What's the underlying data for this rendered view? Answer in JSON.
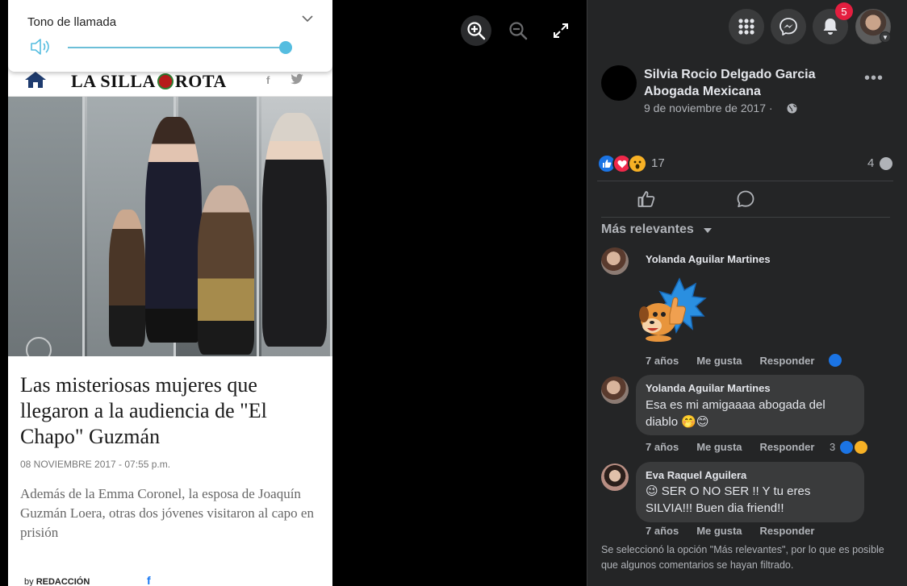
{
  "ringtone": {
    "title": "Tono de llamada",
    "volume": 1.0
  },
  "article": {
    "site_name": "LA SILLA",
    "site_name_2": "ROTA",
    "headline": "Las misteriosas mujeres que llegaron a la audiencia de \"El Chapo\" Guzmán",
    "date": "08 NOVIEMBRE 2017 - 07:55 p.m.",
    "lead": "Además de la Emma Coronel, la esposa de Joaquín Guzmán Loera, otras dos jóvenes visitaron al capo en prisión",
    "byline_prefix": "by ",
    "byline_author": "REDACCIÓN",
    "social_fb": "f"
  },
  "viewer": {
    "zoom_in": "zoom-in",
    "zoom_out": "zoom-out",
    "fullscreen": "fullscreen"
  },
  "topbar": {
    "notifications_count": "5"
  },
  "post": {
    "author": "Silvia Rocio Delgado Garcia Abogada Mexicana",
    "date": "9 de noviembre de 2017 ·",
    "menu": "•••",
    "reactions_count": "17",
    "comments_count": "4"
  },
  "comments_section": {
    "sort_label": "Más relevantes",
    "comments": [
      {
        "author": "Yolanda Aguilar Martines",
        "text": "",
        "age": "7 años",
        "like": "Me gusta",
        "reply": "Responder"
      },
      {
        "author": "Yolanda Aguilar Martines",
        "text": "Esa es mi amigaaaa abogada del diablo 🤭😊",
        "age": "7 años",
        "like": "Me gusta",
        "reply": "Responder",
        "reaction_count": "3"
      },
      {
        "author": "Eva Raquel Aguilera",
        "text": "😉 SER O NO SER !! Y tu eres SILVIA!!! Buen dia friend!!",
        "age": "7 años",
        "like": "Me gusta",
        "reply": "Responder"
      }
    ],
    "footer_note": "Se seleccionó la opción \"Más relevantes\", por lo que es posible que algunos comentarios se hayan filtrado."
  },
  "colors": {
    "panel_bg": "#242526",
    "bubble_bg": "#3a3b3c",
    "accent_blue": "#1b74e4",
    "badge_red": "#e41e3f",
    "slider_blue": "#55bde0"
  }
}
